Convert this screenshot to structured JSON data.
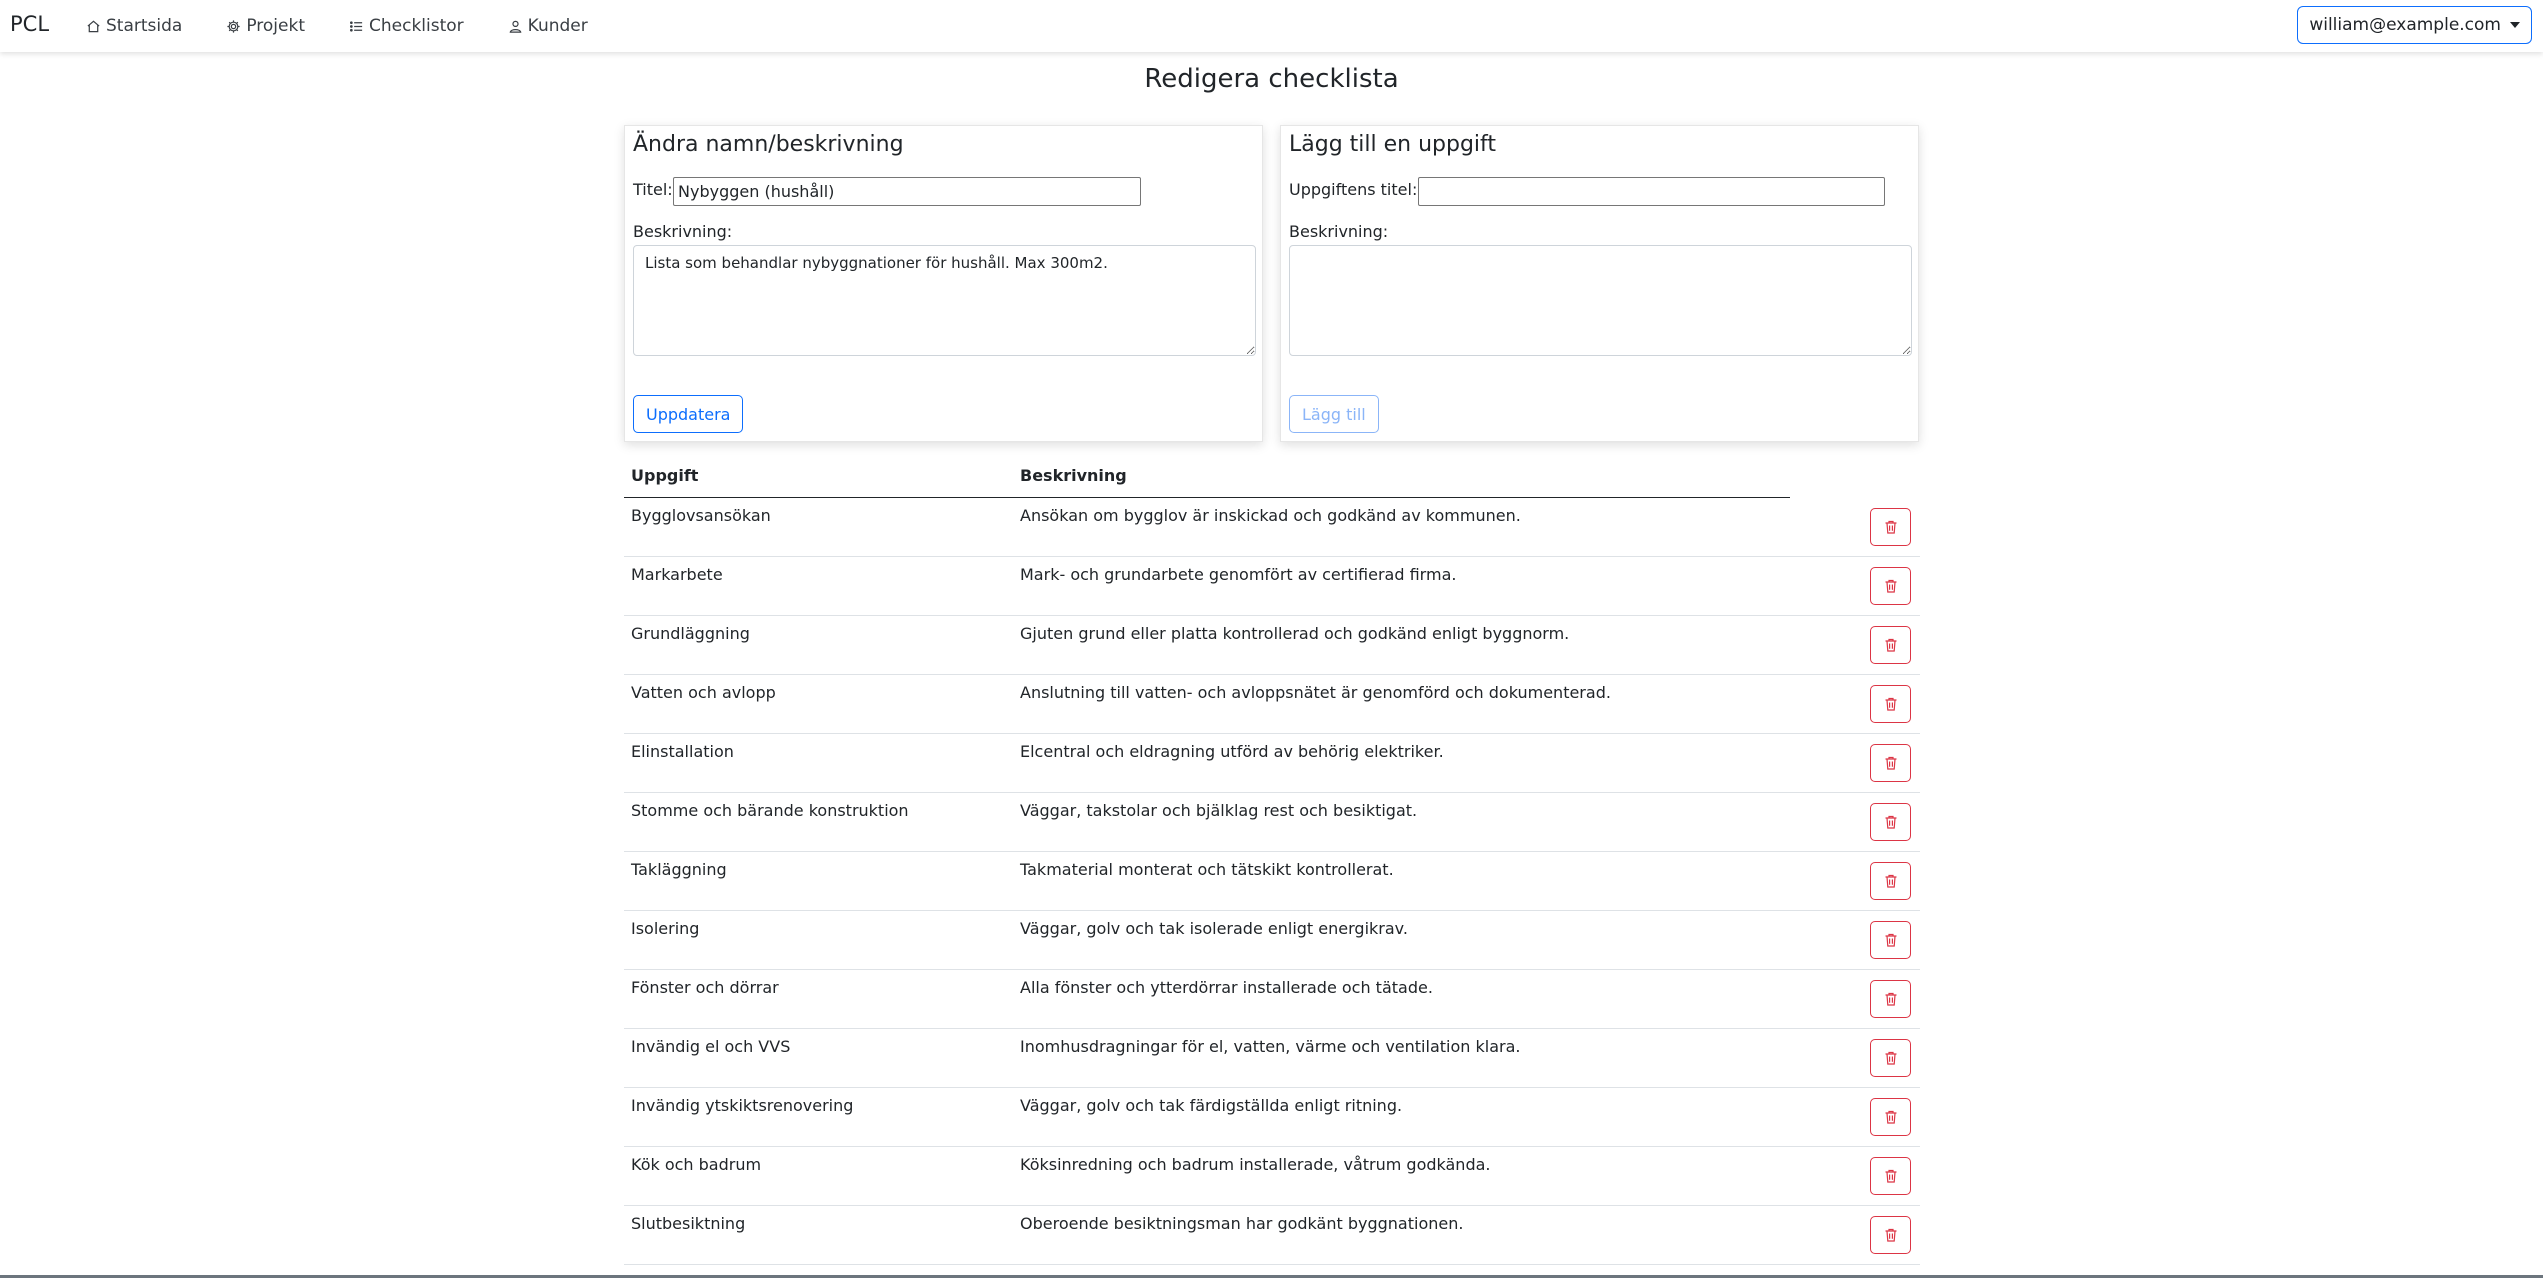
{
  "navbar": {
    "brand": "PCL",
    "links": [
      {
        "label": "Startsida",
        "icon": "house-icon"
      },
      {
        "label": "Projekt",
        "icon": "gear-icon"
      },
      {
        "label": "Checklistor",
        "icon": "list-icon"
      },
      {
        "label": "Kunder",
        "icon": "person-icon"
      }
    ],
    "user_email": "william@example.com"
  },
  "page": {
    "title": "Redigera checklista"
  },
  "edit_card": {
    "heading": "Ändra namn/beskrivning",
    "title_label": "Titel:",
    "title_value": "Nybyggen (hushåll)",
    "description_label": "Beskrivning:",
    "description_value": "Lista som behandlar nybyggnationer för hushåll. Max 300m2.",
    "button_label": "Uppdatera"
  },
  "add_card": {
    "heading": "Lägg till en uppgift",
    "title_label": "Uppgiftens titel:",
    "title_value": "",
    "description_label": "Beskrivning:",
    "description_value": "",
    "button_label": "Lägg till"
  },
  "table": {
    "headers": {
      "task": "Uppgift",
      "description": "Beskrivning"
    },
    "rows": [
      {
        "task": "Bygglovsansökan",
        "description": "Ansökan om bygglov är inskickad och godkänd av kommunen."
      },
      {
        "task": "Markarbete",
        "description": "Mark- och grundarbete genomfört av certifierad firma."
      },
      {
        "task": "Grundläggning",
        "description": "Gjuten grund eller platta kontrollerad och godkänd enligt byggnorm."
      },
      {
        "task": "Vatten och avlopp",
        "description": "Anslutning till vatten- och avloppsnätet är genomförd och dokumenterad."
      },
      {
        "task": "Elinstallation",
        "description": "Elcentral och eldragning utförd av behörig elektriker."
      },
      {
        "task": "Stomme och bärande konstruktion",
        "description": "Väggar, takstolar och bjälklag rest och besiktigat."
      },
      {
        "task": "Takläggning",
        "description": "Takmaterial monterat och tätskikt kontrollerat."
      },
      {
        "task": "Isolering",
        "description": "Väggar, golv och tak isolerade enligt energikrav."
      },
      {
        "task": "Fönster och dörrar",
        "description": "Alla fönster och ytterdörrar installerade och tätade."
      },
      {
        "task": "Invändig el och VVS",
        "description": "Inomhusdragningar för el, vatten, värme och ventilation klara."
      },
      {
        "task": "Invändig ytskiktsrenovering",
        "description": "Väggar, golv och tak färdigställda enligt ritning."
      },
      {
        "task": "Kök och badrum",
        "description": "Köksinredning och badrum installerade, våtrum godkända."
      },
      {
        "task": "Slutbesiktning",
        "description": "Oberoende besiktningsman har godkänt byggnationen."
      }
    ]
  },
  "colors": {
    "primary": "#0d6efd",
    "danger": "#dc3545",
    "text": "#212529"
  }
}
